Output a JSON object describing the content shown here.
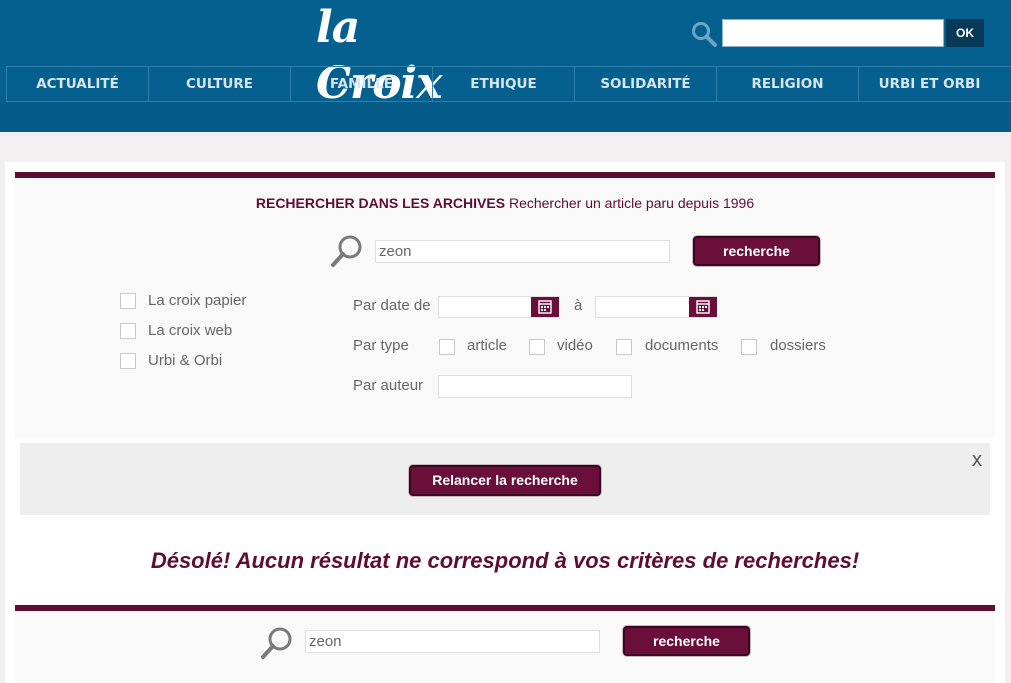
{
  "header": {
    "logo": "la Croix",
    "search": {
      "value": "",
      "ok_label": "OK"
    },
    "nav": [
      "ACTUALITÉ",
      "CULTURE",
      "FAMILLE",
      "ETHIQUE",
      "SOLIDARITÉ",
      "RELIGION",
      "URBI ET ORBI"
    ]
  },
  "archives": {
    "title": "RECHERCHER DANS LES ARCHIVES",
    "subtitle": "Rechercher un article paru depuis 1996",
    "query": "zeon",
    "search_label": "recherche",
    "sources": [
      "La croix papier",
      "La croix web",
      "Urbi & Orbi"
    ],
    "date_label": "Par date de",
    "date_to_label": "à",
    "type_label": "Par type",
    "types": [
      "article",
      "vidéo",
      "documents",
      "dossiers"
    ],
    "author_label": "Par auteur",
    "relaunch_label": "Relancer la recherche",
    "close_label": "x"
  },
  "results": {
    "empty_message": "Désolé! Aucun résultat ne correspond à vos critères de recherches!"
  },
  "bottom_search": {
    "query": "zeon",
    "search_label": "recherche"
  },
  "colors": {
    "header_blue": "#05608f",
    "accent_burgundy": "#6a0f3a"
  }
}
